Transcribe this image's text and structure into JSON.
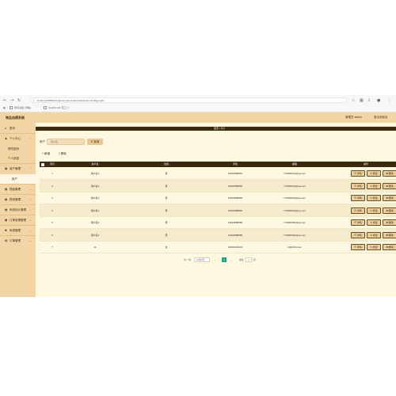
{
  "browser": {
    "url": "localhost:8080/springboot-tmfsm/admin/dist/index.html#/yonghu",
    "bookmarks": [
      "所有书签 | 网站...",
      "Graphic HK 高工 C..."
    ]
  },
  "header": {
    "title": "物品血模系统",
    "admin_label": "管理员 admin",
    "logout_label": "退出到前台"
  },
  "sidebar": {
    "items": [
      {
        "label": "首页",
        "icon": "home-icon"
      },
      {
        "label": "个人中心",
        "icon": "user-icon"
      },
      {
        "label": "修改密码",
        "sub": true
      },
      {
        "label": "个人信息",
        "sub": true
      },
      {
        "label": "用户管理",
        "icon": "grid-icon"
      },
      {
        "label": "用户",
        "sub": true,
        "active": true
      },
      {
        "label": "物品管理",
        "icon": "grid-icon"
      },
      {
        "label": "物流管理",
        "icon": "grid-icon"
      },
      {
        "label": "系统设计管理",
        "icon": "grid-icon"
      },
      {
        "label": "订单查理管理",
        "icon": "grid-icon"
      },
      {
        "label": "系统管理",
        "icon": "gear-icon"
      },
      {
        "label": "订单管理",
        "icon": "doc-icon"
      }
    ]
  },
  "breadcrumb": {
    "home": "首页",
    "sep": "/",
    "current": "用户"
  },
  "search": {
    "label": "用户",
    "placeholder": "用户名",
    "button": "查询"
  },
  "toolbar": {
    "add": "新增",
    "delete": "删除"
  },
  "table": {
    "columns": [
      "索引",
      "用户名",
      "性别",
      "手机",
      "邮箱",
      "操作"
    ],
    "rows": [
      {
        "index": "1",
        "name": "用户名1",
        "gender": "男",
        "phone": "13823888881",
        "email": "773890001@qq.com"
      },
      {
        "index": "2",
        "name": "用户名2",
        "gender": "男",
        "phone": "13823888882",
        "email": "773890002@qq.com"
      },
      {
        "index": "3",
        "name": "用户名3",
        "gender": "男",
        "phone": "13823888883",
        "email": "773890003@qq.com"
      },
      {
        "index": "4",
        "name": "用户名4",
        "gender": "男",
        "phone": "13823888884",
        "email": "773890004@qq.com"
      },
      {
        "index": "5",
        "name": "用户名5",
        "gender": "男",
        "phone": "13823888885",
        "email": "773890005@qq.com"
      },
      {
        "index": "6",
        "name": "用户名6",
        "gender": "男",
        "phone": "13823888886",
        "email": "773890006@qq.com"
      },
      {
        "index": "7",
        "name": "11",
        "gender": "女",
        "phone": "19922222222",
        "email": "22@163.com"
      }
    ],
    "actions": {
      "detail": "详情",
      "edit": "修改",
      "delete": "删除"
    }
  },
  "pagination": {
    "total": "共 7 条",
    "page_size": "10条/页",
    "prev": "‹",
    "current_page": "1",
    "next": "›",
    "goto_label": "前往",
    "goto_value": "1",
    "page_suffix": "页"
  }
}
